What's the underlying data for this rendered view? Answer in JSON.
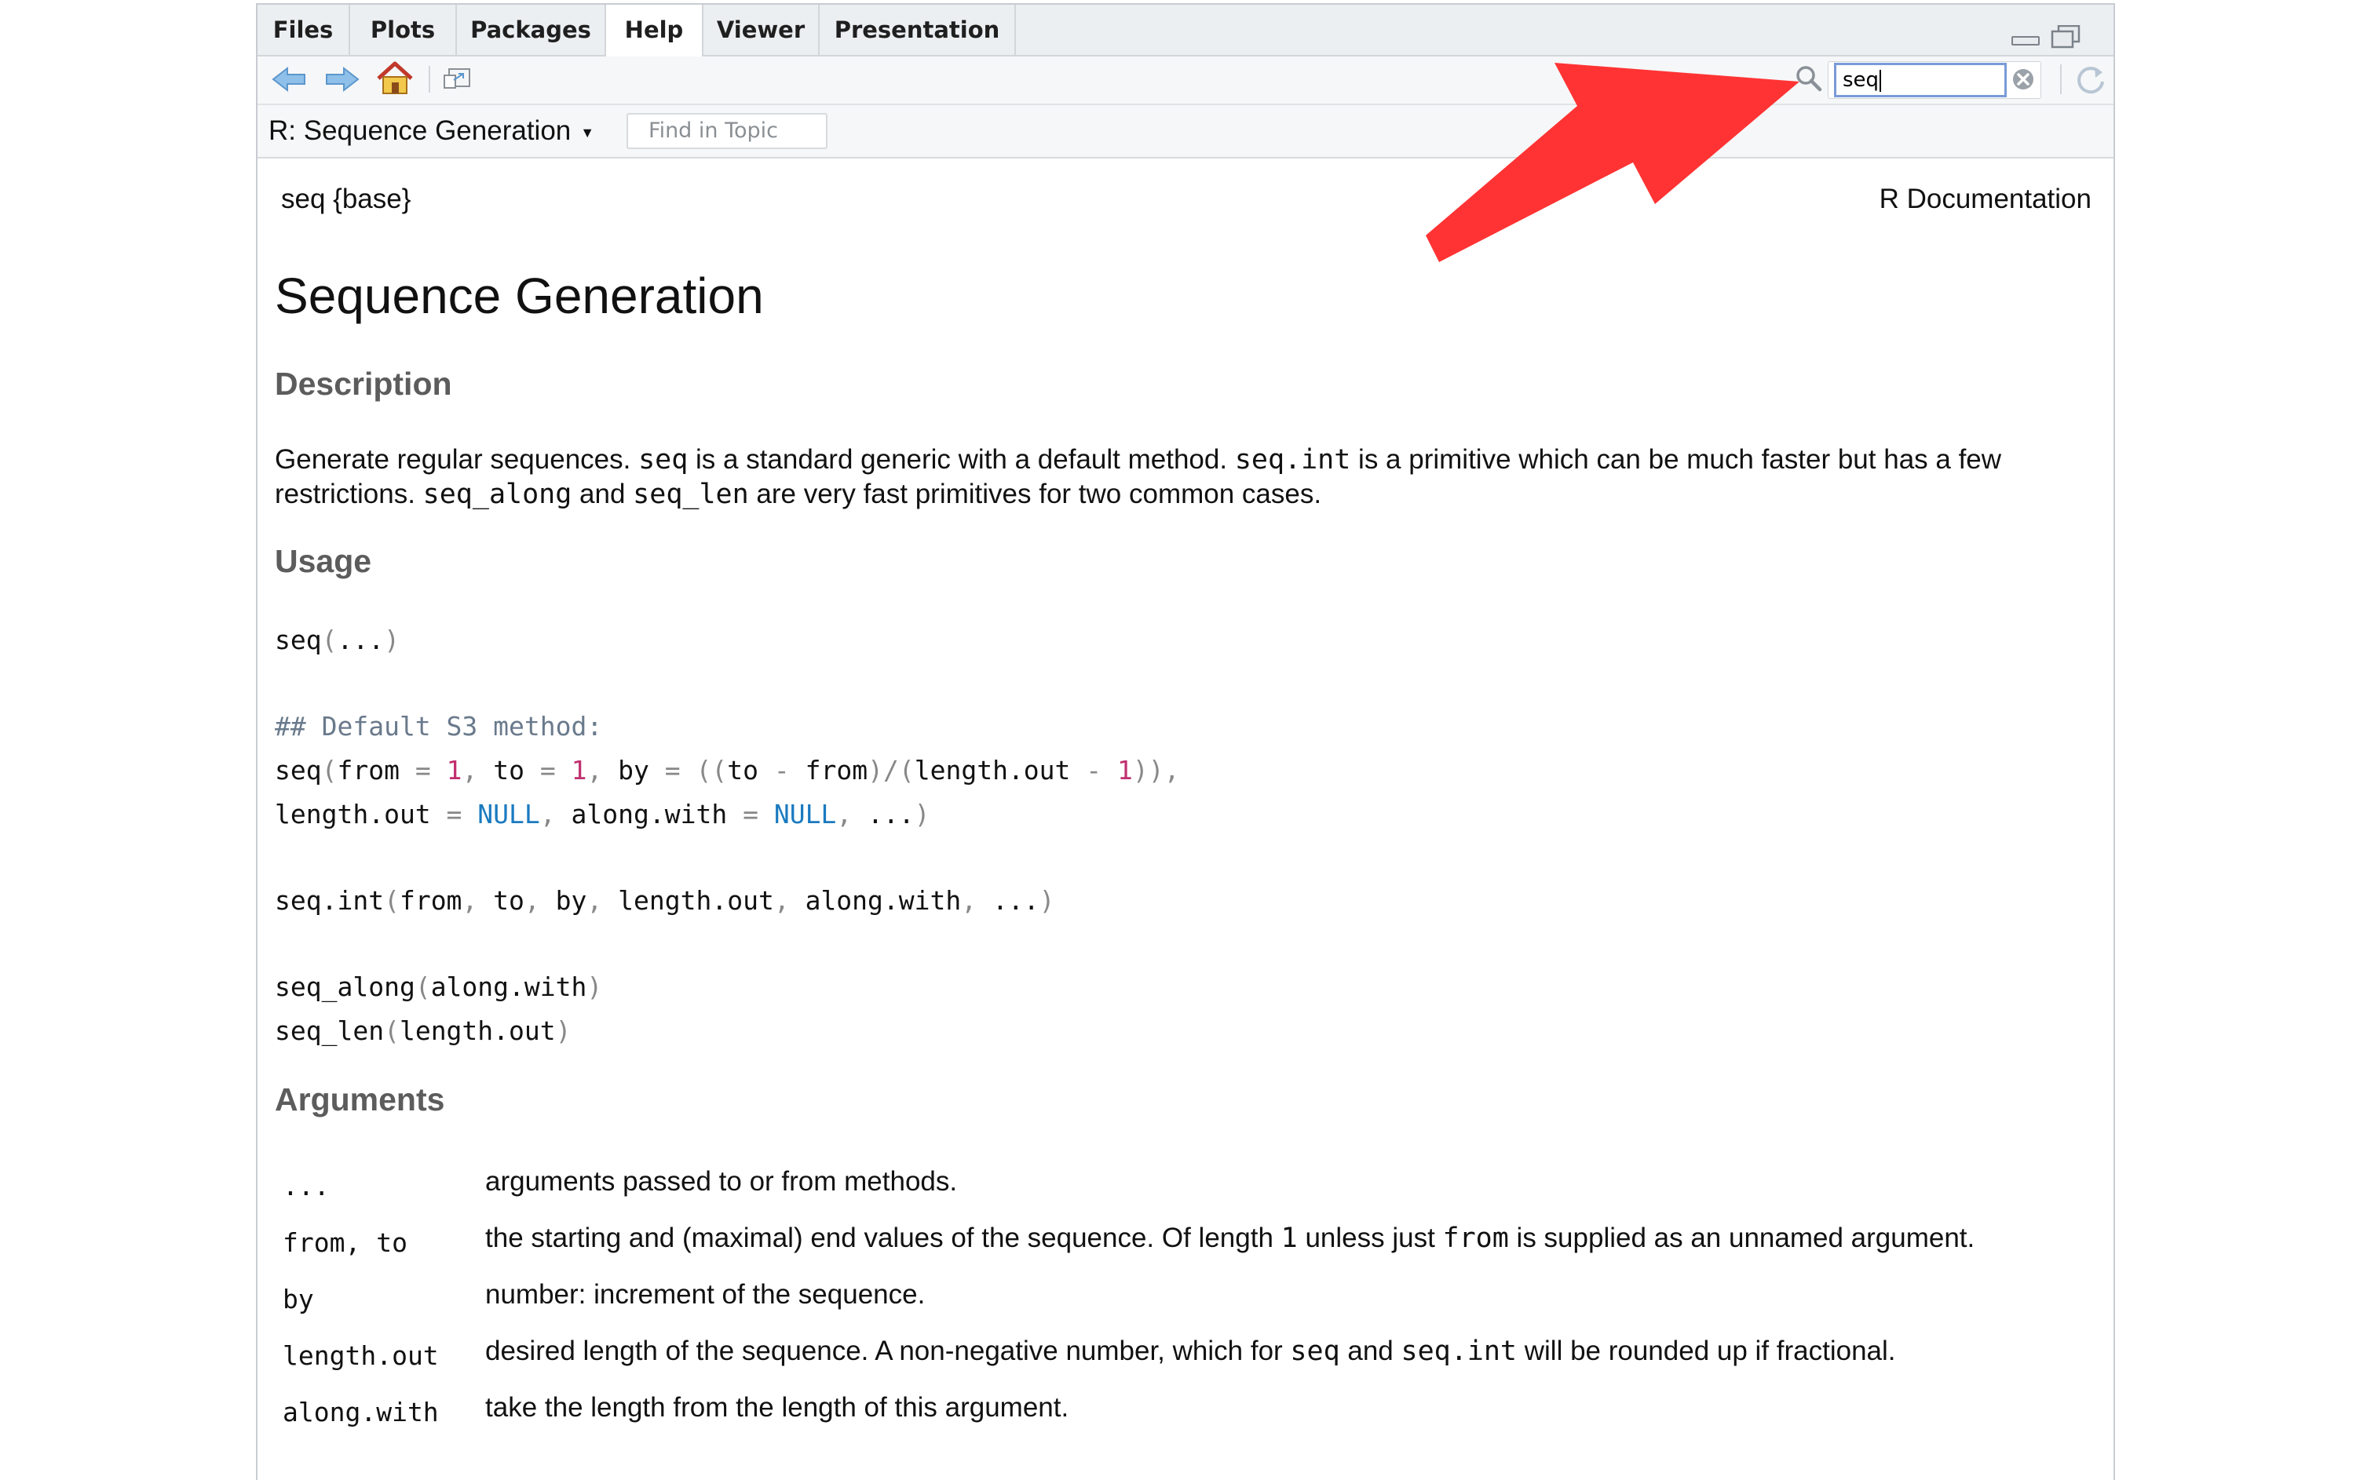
{
  "tabs": [
    {
      "label": "Files"
    },
    {
      "label": "Plots"
    },
    {
      "label": "Packages"
    },
    {
      "label": "Help",
      "active": true
    },
    {
      "label": "Viewer"
    },
    {
      "label": "Presentation"
    }
  ],
  "toolbar": {
    "back_icon": "arrow-left-icon",
    "forward_icon": "arrow-right-icon",
    "home_icon": "home-icon",
    "popout_icon": "popout-icon",
    "search_value": "seq",
    "refresh_icon": "refresh-icon"
  },
  "topic": {
    "title": "R: Sequence Generation",
    "find_placeholder": "Find in Topic"
  },
  "doc": {
    "package_tag": "seq {base}",
    "doc_label": "R Documentation",
    "title": "Sequence Generation",
    "description_heading": "Description",
    "description": {
      "p1_a": "Generate regular sequences. ",
      "p1_code1": "seq",
      "p1_b": " is a standard generic with a default method. ",
      "p1_code2": "seq.int",
      "p1_c": " is a primitive which can be much faster but has a few",
      "p2_a": "restrictions. ",
      "p2_code1": "seq_along",
      "p2_b": " and ",
      "p2_code2": "seq_len",
      "p2_c": " are very fast primitives for two common cases."
    },
    "usage_heading": "Usage",
    "arguments_heading": "Arguments",
    "arguments": [
      {
        "name": "...",
        "desc_parts": [
          "arguments passed to or from methods."
        ]
      },
      {
        "name": "from, to",
        "desc_parts": [
          "the starting and (maximal) end values of the sequence. Of length ",
          "1",
          " unless just ",
          "from",
          " is supplied as an unnamed argument."
        ]
      },
      {
        "name": "by",
        "desc_parts": [
          "number: increment of the sequence."
        ]
      },
      {
        "name": "length.out",
        "desc_parts": [
          "desired length of the sequence. A non-negative number, which for ",
          "seq",
          " and ",
          "seq.int",
          " will be rounded up if fractional."
        ]
      },
      {
        "name": "along.with",
        "desc_parts": [
          "take the length from the length of this argument."
        ]
      }
    ]
  },
  "colors": {
    "annotation_arrow": "#ff3333",
    "heading": "#5c5c5c",
    "code_comment": "#6a7a8c",
    "code_number": "#c03070",
    "code_keyword": "#1a7ac0",
    "search_focus": "#7a9ad8"
  }
}
